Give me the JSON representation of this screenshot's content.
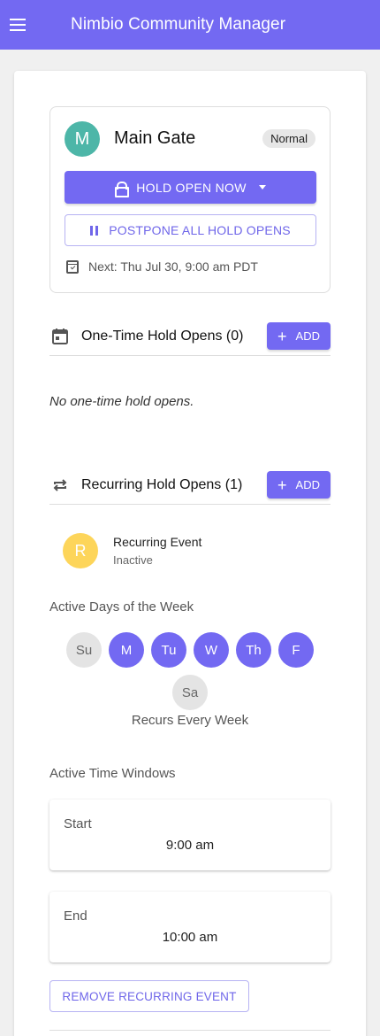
{
  "appbar": {
    "title": "Nimbio Community Manager"
  },
  "gate": {
    "avatar_letter": "M",
    "name": "Main Gate",
    "status_badge": "Normal",
    "hold_open_label": "HOLD OPEN NOW",
    "postpone_label": "POSTPONE ALL HOLD OPENS",
    "next_text": "Next: Thu Jul 30, 9:00 am PDT"
  },
  "one_time": {
    "title": "One-Time Hold Opens (0)",
    "add_label": "ADD",
    "empty_message": "No one-time hold opens."
  },
  "recurring": {
    "title": "Recurring Hold Opens (1)",
    "add_label": "ADD",
    "event": {
      "avatar_letter": "R",
      "name": "Recurring Event",
      "status": "Inactive"
    },
    "active_days_label": "Active Days of the Week",
    "days": [
      {
        "label": "Su",
        "active": false
      },
      {
        "label": "M",
        "active": true
      },
      {
        "label": "Tu",
        "active": true
      },
      {
        "label": "W",
        "active": true
      },
      {
        "label": "Th",
        "active": true
      },
      {
        "label": "F",
        "active": true
      },
      {
        "label": "Sa",
        "active": false
      }
    ],
    "recurs_text": "Recurs Every Week",
    "time_windows_label": "Active Time Windows",
    "start_label": "Start",
    "start_value": "9:00 am",
    "end_label": "End",
    "end_value": "10:00 am",
    "remove_label": "REMOVE RECURRING EVENT"
  },
  "colors": {
    "accent": "#7369f2",
    "teal_avatar": "#4db6a8",
    "yellow_avatar": "#fdd55a"
  }
}
